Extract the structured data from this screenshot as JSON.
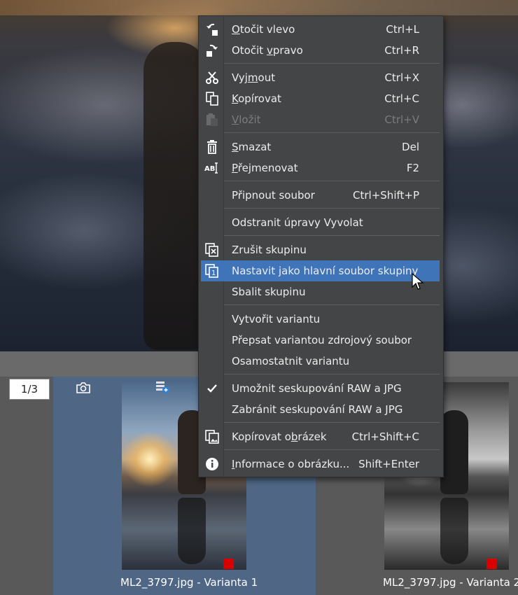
{
  "menu": {
    "items": [
      {
        "label_pre": "",
        "label_u": "O",
        "label_post": "točit vlevo",
        "shortcut": "Ctrl+L",
        "icon": "rotate-left-icon",
        "disabled": false
      },
      {
        "label_pre": "Otočit ",
        "label_u": "v",
        "label_post": "pravo",
        "shortcut": "Ctrl+R",
        "icon": "rotate-right-icon",
        "disabled": false
      },
      {
        "label_pre": "Vyj",
        "label_u": "m",
        "label_post": "out",
        "shortcut": "Ctrl+X",
        "icon": "scissors-icon",
        "disabled": false
      },
      {
        "label_pre": "",
        "label_u": "K",
        "label_post": "opírovat",
        "shortcut": "Ctrl+C",
        "icon": "copy-icon",
        "disabled": false
      },
      {
        "label_pre": "",
        "label_u": "V",
        "label_post": "ložit",
        "shortcut": "Ctrl+V",
        "icon": "paste-icon",
        "disabled": true
      },
      {
        "label_pre": "",
        "label_u": "S",
        "label_post": "mazat",
        "shortcut": "Del",
        "icon": "trash-icon",
        "disabled": false
      },
      {
        "label_pre": "",
        "label_u": "P",
        "label_post": "řejmenovat",
        "shortcut": "F2",
        "icon": "rename-icon",
        "disabled": false
      },
      {
        "label_pre": "Připnout soubor",
        "label_u": "",
        "label_post": "",
        "shortcut": "Ctrl+Shift+P",
        "icon": "",
        "disabled": false
      },
      {
        "label_pre": "Odstranit úpravy Vyvolat",
        "label_u": "",
        "label_post": "",
        "shortcut": "",
        "icon": "",
        "disabled": false
      },
      {
        "label_pre": "Zrušit skupinu",
        "label_u": "",
        "label_post": "",
        "shortcut": "",
        "icon": "ungroup-icon",
        "disabled": false
      },
      {
        "label_pre": "Nastavit jako hlavní soubor skupiny",
        "label_u": "",
        "label_post": "",
        "shortcut": "",
        "icon": "group-main-icon",
        "disabled": false,
        "highlighted": true
      },
      {
        "label_pre": "Sbalit skupinu",
        "label_u": "",
        "label_post": "",
        "shortcut": "",
        "icon": "",
        "disabled": false
      },
      {
        "label_pre": "Vytvořit variantu",
        "label_u": "",
        "label_post": "",
        "shortcut": "",
        "icon": "",
        "disabled": false
      },
      {
        "label_pre": "Přepsat variantou zdrojový soubor",
        "label_u": "",
        "label_post": "",
        "shortcut": "",
        "icon": "",
        "disabled": false
      },
      {
        "label_pre": "Osamostatnit variantu",
        "label_u": "",
        "label_post": "",
        "shortcut": "",
        "icon": "",
        "disabled": false
      },
      {
        "label_pre": "Umožnit seskupování RAW a JPG",
        "label_u": "",
        "label_post": "",
        "shortcut": "",
        "icon": "checkmark-icon",
        "disabled": false
      },
      {
        "label_pre": "Zabránit seskupování RAW a JPG",
        "label_u": "",
        "label_post": "",
        "shortcut": "",
        "icon": "",
        "disabled": false
      },
      {
        "label_pre": "Kopírovat o",
        "label_u": "b",
        "label_post": "rázek",
        "shortcut": "Ctrl+Shift+C",
        "icon": "copy-image-icon",
        "disabled": false
      },
      {
        "label_pre": "",
        "label_u": "I",
        "label_post": "nformace o obrázku...",
        "shortcut": "Shift+Enter",
        "icon": "info-icon",
        "disabled": false
      }
    ]
  },
  "filmstrip": {
    "counter": "1/3",
    "thumbnails": [
      {
        "label": "ML2_3797.jpg - Varianta 1",
        "selected": true,
        "flag_color": "#d90000"
      },
      {
        "label": "ML2_3797.jpg - Varianta 2",
        "selected": false,
        "flag_color": "#d90000"
      }
    ]
  },
  "colors": {
    "menu_bg": "#444546",
    "highlight": "#3f74b8",
    "selected_thumb_bg": "#4f6785"
  }
}
